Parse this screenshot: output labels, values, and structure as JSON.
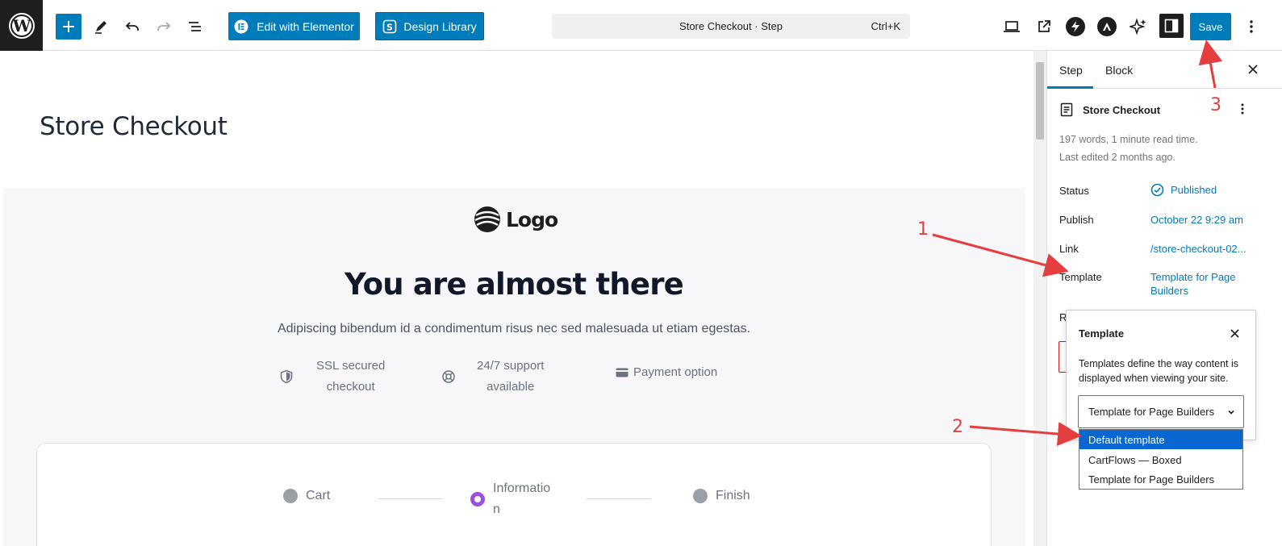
{
  "toolbar": {
    "edit_elementor_label": "Edit with Elementor",
    "design_library_label": "Design Library",
    "command_title": "Store Checkout · Step",
    "command_shortcut": "Ctrl+K",
    "save_label": "Save"
  },
  "canvas": {
    "post_title": "Store Checkout",
    "logo_text": "Logo",
    "hero_heading": "You are almost there",
    "hero_subtitle": "Adipiscing bibendum id a condimentum risus nec sed malesuada ut etiam egestas.",
    "badges": [
      {
        "line1": "SSL secured",
        "line2": "checkout",
        "icon": "shield-icon"
      },
      {
        "line1": "24/7 support",
        "line2": "available",
        "icon": "lifebuoy-icon"
      },
      {
        "line1": "Payment option",
        "icon": "credit-card-icon"
      }
    ],
    "steps": [
      {
        "label": "Cart"
      },
      {
        "line1": "Informatio",
        "line2": "n"
      },
      {
        "label": "Finish"
      }
    ]
  },
  "sidebar": {
    "tabs": [
      "Step",
      "Block"
    ],
    "doc_title": "Store Checkout",
    "word_count": "197 words, 1 minute read time.",
    "last_edited": "Last edited 2 months ago.",
    "rows": {
      "status_label": "Status",
      "status_value": "Published",
      "publish_label": "Publish",
      "publish_value": "October 22 9:29 am",
      "link_label": "Link",
      "link_value": "/store-checkout-02...",
      "template_label": "Template",
      "template_value_1": "Template for Page",
      "template_value_2": "Builders",
      "hidden_r": "R"
    }
  },
  "template_popover": {
    "title": "Template",
    "desc_1": "Templates define the way content is",
    "desc_2": "displayed when viewing your site.",
    "selected": "Template for Page Builders",
    "options": [
      "Default template",
      "CartFlows — Boxed",
      "Template for Page Builders"
    ]
  },
  "annotations": [
    "1",
    "2",
    "3"
  ],
  "colors": {
    "wp_blue": "#007cba",
    "annotation_red": "#e53e3e",
    "step_active_purple": "#9b51e0",
    "dropdown_highlight": "#0a66d1"
  }
}
